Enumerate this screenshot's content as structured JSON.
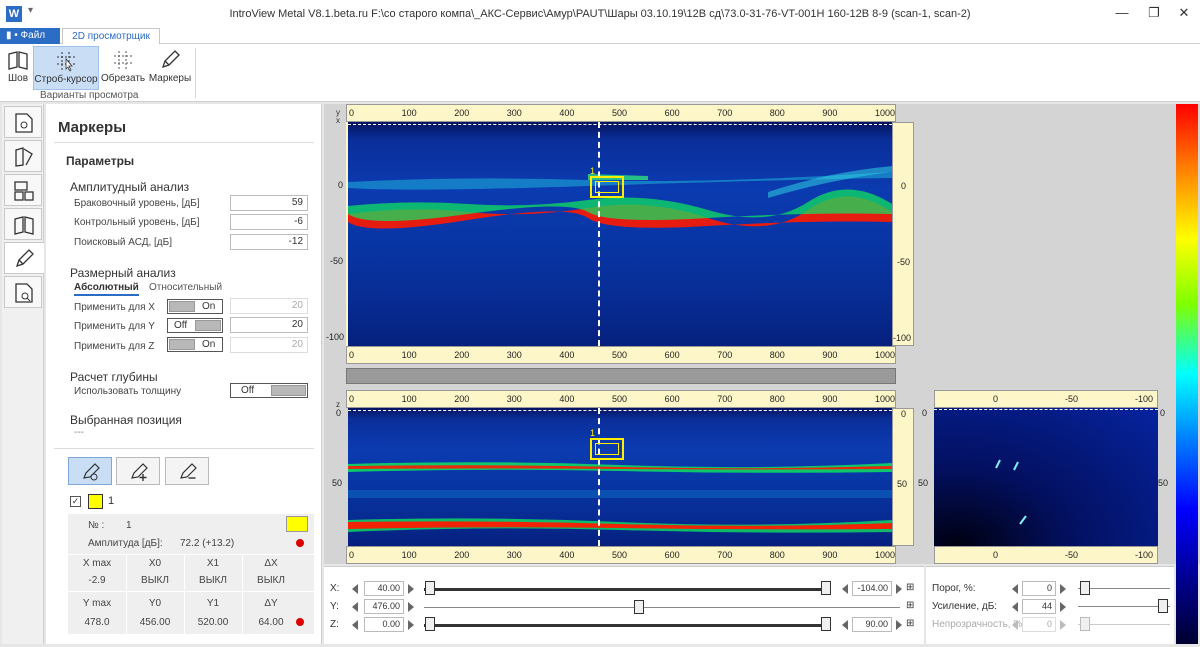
{
  "titlebar": {
    "title": "IntroView Metal V8.1.beta.ru    F:\\со старого компа\\_АКС-Сервис\\Амур\\PAUT\\Шары 03.10.19\\12В сд\\73.0-31-76-VT-001H 160-12В 8-9 (scan-1, scan-2)",
    "app_icon": "W",
    "minimize": "—",
    "maximize": "❐",
    "close": "✕"
  },
  "tabs": {
    "file": "▮ • Файл",
    "view": "2D просмотрщик"
  },
  "ribbon": {
    "buttons": [
      {
        "label": "Шов",
        "icon": "book-icon"
      },
      {
        "label": "Строб-курсор",
        "icon": "gate-cursor-icon"
      },
      {
        "label": "Обрезать",
        "icon": "crop-grid-icon"
      },
      {
        "label": "Маркеры",
        "icon": "pencil-icon"
      }
    ],
    "group_label": "Варианты просмотра"
  },
  "panel": {
    "title": "Маркеры",
    "params_title": "Параметры",
    "amplitude": {
      "title": "Амплитудный анализ",
      "rows": [
        {
          "label": "Браковочный уровень, [дБ]",
          "value": "59"
        },
        {
          "label": "Контрольный уровень, [дБ]",
          "value": "-6"
        },
        {
          "label": "Поисковый АСД, [дБ]",
          "value": "-12"
        }
      ]
    },
    "size": {
      "title": "Размерный анализ",
      "tab_abs": "Абсолютный",
      "tab_rel": "Относительный",
      "rows": [
        {
          "label": "Применить для X",
          "toggle": "On",
          "value": "20"
        },
        {
          "label": "Применить для Y",
          "toggle": "Off",
          "value": "20"
        },
        {
          "label": "Применить для Z",
          "toggle": "On",
          "value": "20"
        }
      ]
    },
    "depth": {
      "title": "Расчет глубины",
      "label": "Использовать толщину",
      "toggle": "Off"
    },
    "selected": {
      "title": "Выбранная позиция",
      "value": "---"
    },
    "marker": {
      "name": "1",
      "color": "#ffff00",
      "num_label": "№ :",
      "num_value": "1",
      "amp_label": "Амплитуда [дБ]:",
      "amp_value": "72.2 (+13.2)",
      "head1": [
        "X max",
        "X0",
        "X1",
        "ΔX"
      ],
      "row1": [
        "-2.9",
        "ВЫКЛ",
        "ВЫКЛ",
        "ВЫКЛ"
      ],
      "head2": [
        "Y max",
        "Y0",
        "Y1",
        "ΔY"
      ],
      "row2": [
        "478.0",
        "456.00",
        "520.00",
        "64.00"
      ]
    }
  },
  "views": {
    "top_x_ticks": [
      "0",
      "100",
      "200",
      "300",
      "400",
      "500",
      "600",
      "700",
      "800",
      "900",
      "1000"
    ],
    "top_y_ticks": [
      "0",
      "-50",
      "-100"
    ],
    "bottom_y_ticks": [
      "0",
      "50"
    ],
    "right_x_ticks": [
      "0",
      "-50",
      "-100"
    ],
    "right_y_ticks": [
      "0",
      "50"
    ],
    "axis_letter_y": "y",
    "axis_letter_x": "x",
    "axis_letter_z": "z",
    "gate_label": "1"
  },
  "controls": {
    "x": {
      "label": "X:",
      "left": "40.00",
      "right": "-104.00"
    },
    "y": {
      "label": "Y:",
      "left": "476.00"
    },
    "z": {
      "label": "Z:",
      "left": "0.00",
      "right": "90.00"
    },
    "threshold": {
      "label": "Порог, %:",
      "value": "0"
    },
    "gain": {
      "label": "Усиление, дБ:",
      "value": "44"
    },
    "opacity": {
      "label": "Непрозрачность, %",
      "value": "0"
    }
  }
}
